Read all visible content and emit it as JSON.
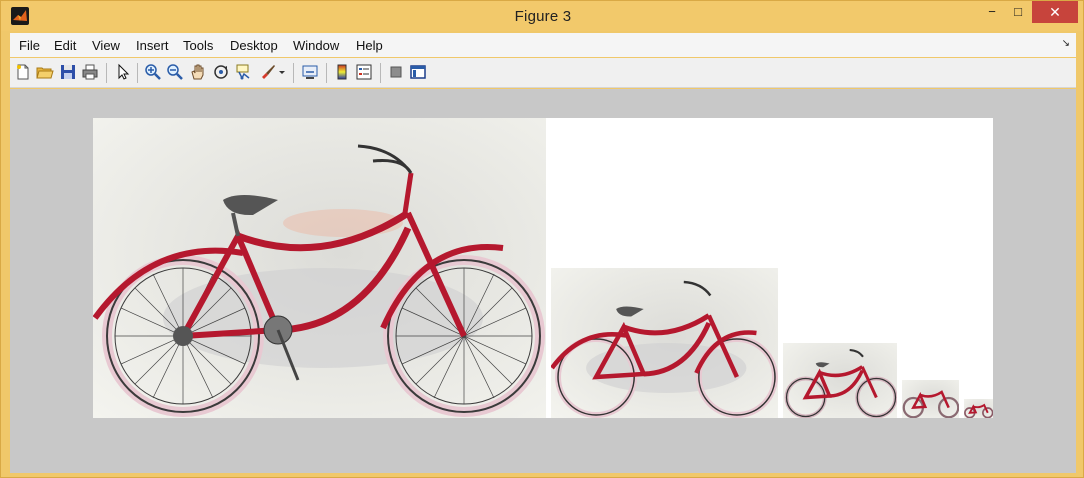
{
  "window": {
    "title": "Figure 3",
    "controls": {
      "minimize": "−",
      "maximize": "□",
      "close": "✕"
    }
  },
  "menu": {
    "items": [
      "File",
      "Edit",
      "View",
      "Insert",
      "Tools",
      "Desktop",
      "Window",
      "Help"
    ],
    "overflow_arrow": "↘"
  },
  "toolbar": {
    "buttons": [
      "new-figure",
      "open-file",
      "save-figure",
      "print-figure",
      "edit-plot",
      "zoom-in",
      "zoom-out",
      "pan",
      "rotate-3d",
      "data-cursor",
      "brush",
      "link-plot",
      "insert-colorbar",
      "insert-legend",
      "hide-plot-tools",
      "show-plot-tools"
    ]
  },
  "figure": {
    "background_color": "#c8c8c8",
    "content": "image-pyramid",
    "pyramid_levels": 5
  },
  "colors": {
    "titlebar": "#f2c96b",
    "close_button": "#c7443c",
    "bike_frame": "#b5182e"
  }
}
